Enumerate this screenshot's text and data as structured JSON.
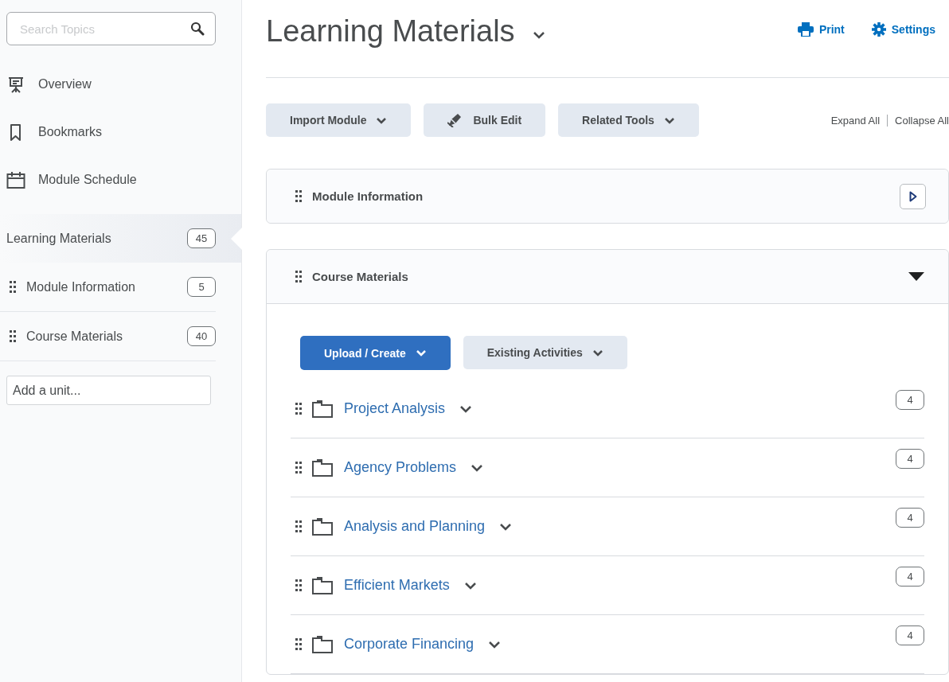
{
  "sidebar": {
    "search": {
      "placeholder": "Search Topics"
    },
    "nav": [
      {
        "kind": "overview",
        "label": "Overview"
      },
      {
        "kind": "bookmarks",
        "label": "Bookmarks"
      },
      {
        "kind": "schedule",
        "label": "Module Schedule"
      }
    ],
    "toc": {
      "label": "Learning Materials",
      "count": "45",
      "selected": true
    },
    "units": [
      {
        "label": "Module Information",
        "count": "5",
        "selected": false
      },
      {
        "label": "Course Materials",
        "count": "40",
        "selected": false
      }
    ],
    "add_unit": {
      "placeholder": "Add a unit..."
    }
  },
  "header": {
    "title": "Learning Materials",
    "actions": [
      {
        "kind": "print",
        "label": "Print"
      },
      {
        "kind": "settings",
        "label": "Settings"
      }
    ]
  },
  "toolbar": {
    "buttons": [
      {
        "label": "Import Module",
        "kind": "menu"
      },
      {
        "label": "Bulk Edit",
        "kind": "edit"
      },
      {
        "label": "Related Tools",
        "kind": "menu"
      }
    ],
    "expand_all": "Expand All",
    "collapse_all": "Collapse All"
  },
  "modules": [
    {
      "title": "Module Information",
      "expanded": false
    },
    {
      "title": "Course Materials",
      "expanded": true,
      "buttons": [
        {
          "label": "Upload / Create",
          "primary": true
        },
        {
          "label": "Existing Activities",
          "primary": false
        }
      ],
      "items": [
        {
          "title": "Project Analysis",
          "count": "4"
        },
        {
          "title": "Agency Problems",
          "count": "4"
        },
        {
          "title": "Analysis and Planning",
          "count": "4"
        },
        {
          "title": "Efficient Markets",
          "count": "4"
        },
        {
          "title": "Corporate Financing",
          "count": "4"
        }
      ]
    }
  ]
}
